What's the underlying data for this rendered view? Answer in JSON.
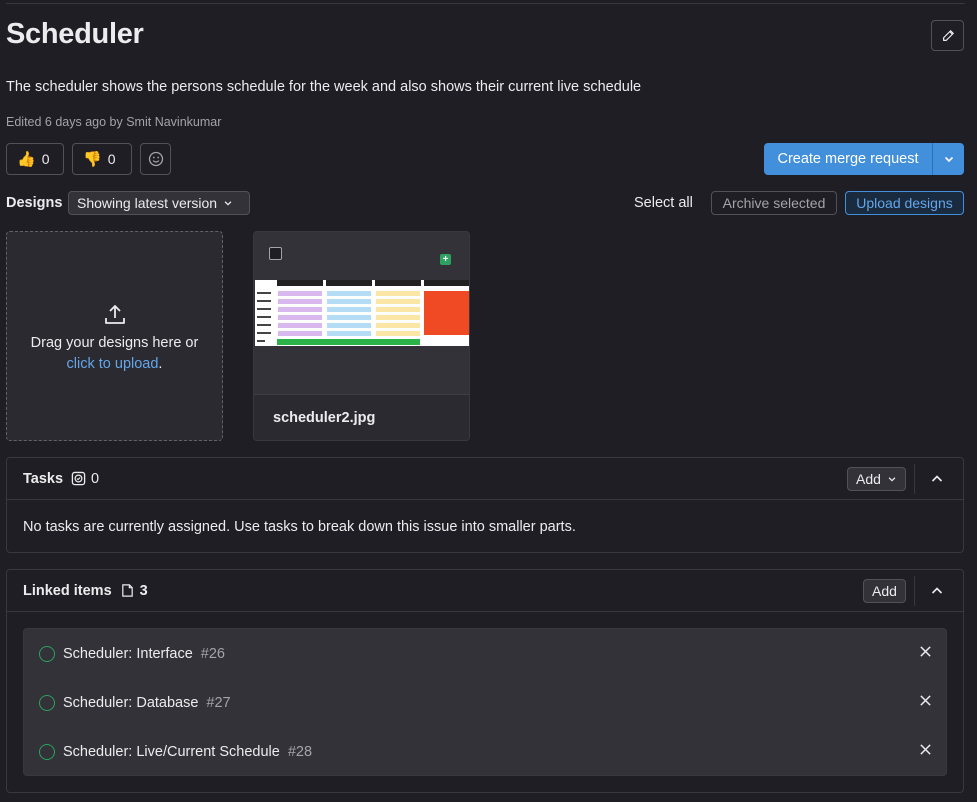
{
  "header": {
    "title": "Scheduler",
    "description": "The scheduler shows the persons schedule for the week and also shows their current live schedule",
    "edited": "Edited 6 days ago by Smit Navinkumar"
  },
  "reactions": {
    "thumbs_up_count": "0",
    "thumbs_down_count": "0"
  },
  "merge_request": {
    "label": "Create merge request"
  },
  "designs": {
    "label": "Designs",
    "version": "Showing latest version",
    "select_all": "Select all",
    "archive_selected": "Archive selected",
    "upload": "Upload designs",
    "dropzone_text": "Drag your designs here or",
    "dropzone_link": "click to upload",
    "dropzone_period": ".",
    "items": [
      {
        "filename": "scheduler2.jpg"
      }
    ]
  },
  "tasks": {
    "title": "Tasks",
    "count": "0",
    "add_label": "Add",
    "empty_text": "No tasks are currently assigned. Use tasks to break down this issue into smaller parts."
  },
  "linked": {
    "title": "Linked items",
    "count": "3",
    "add_label": "Add",
    "items": [
      {
        "title": "Scheduler: Interface",
        "iid": "#26"
      },
      {
        "title": "Scheduler: Database",
        "iid": "#27"
      },
      {
        "title": "Scheduler: Live/Current Schedule",
        "iid": "#28"
      }
    ]
  },
  "colors": {
    "background": "#1f1e24",
    "accent_blue": "#428fdc",
    "link_blue": "#63a6e9",
    "status_open": "#2da160"
  }
}
